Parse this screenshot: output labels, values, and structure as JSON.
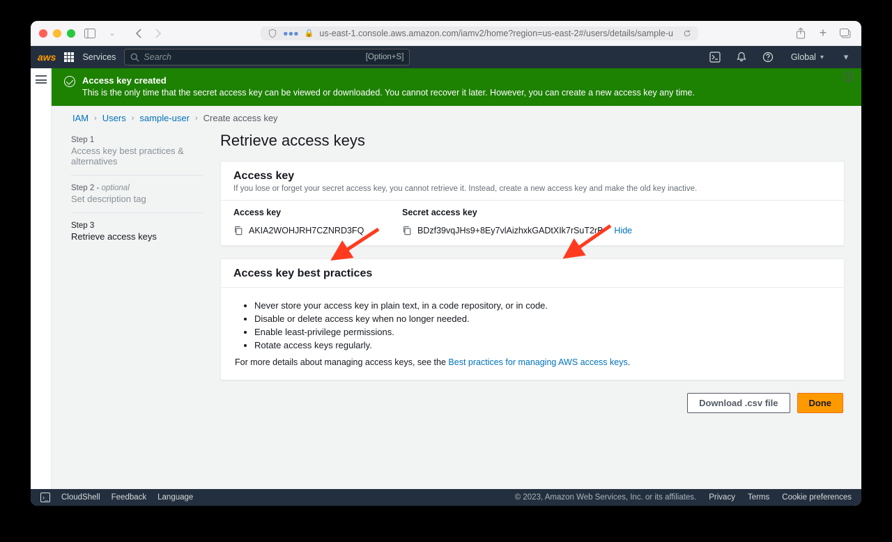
{
  "browser": {
    "url": "us-east-1.console.aws.amazon.com/iamv2/home?region=us-east-2#/users/details/sample-u"
  },
  "nav": {
    "services": "Services",
    "search_placeholder": "Search",
    "search_hint": "[Option+S]",
    "region": "Global"
  },
  "banner": {
    "title": "Access key created",
    "sub": "This is the only time that the secret access key can be viewed or downloaded. You cannot recover it later. However, you can create a new access key any time."
  },
  "breadcrumbs": {
    "b0": "IAM",
    "b1": "Users",
    "b2": "sample-user",
    "b3": "Create access key"
  },
  "steps": {
    "s1_label": "Step 1",
    "s1_title": "Access key best practices & alternatives",
    "s2_label": "Step 2 - ",
    "s2_opt": "optional",
    "s2_title": "Set description tag",
    "s3_label": "Step 3",
    "s3_title": "Retrieve access keys"
  },
  "page_title": "Retrieve access keys",
  "access_panel": {
    "title": "Access key",
    "sub": "If you lose or forget your secret access key, you cannot retrieve it. Instead, create a new access key and make the old key inactive.",
    "col1_label": "Access key",
    "col1_value": "AKIA2WOHJRH7CZNRD3FQ",
    "col2_label": "Secret access key",
    "col2_value": "BDzf39vqJHs9+8Ey7vlAizhxkGADtXIk7rSuT2rB",
    "hide": "Hide"
  },
  "bp_panel": {
    "title": "Access key best practices",
    "li0": "Never store your access key in plain text, in a code repository, or in code.",
    "li1": "Disable or delete access key when no longer needed.",
    "li2": "Enable least-privilege permissions.",
    "li3": "Rotate access keys regularly.",
    "more_pre": "For more details about managing access keys, see the ",
    "more_link": "Best practices for managing AWS access keys"
  },
  "actions": {
    "download": "Download .csv file",
    "done": "Done"
  },
  "footer": {
    "cloudshell": "CloudShell",
    "feedback": "Feedback",
    "language": "Language",
    "copyright": "© 2023, Amazon Web Services, Inc. or its affiliates.",
    "privacy": "Privacy",
    "terms": "Terms",
    "cookies": "Cookie preferences"
  }
}
